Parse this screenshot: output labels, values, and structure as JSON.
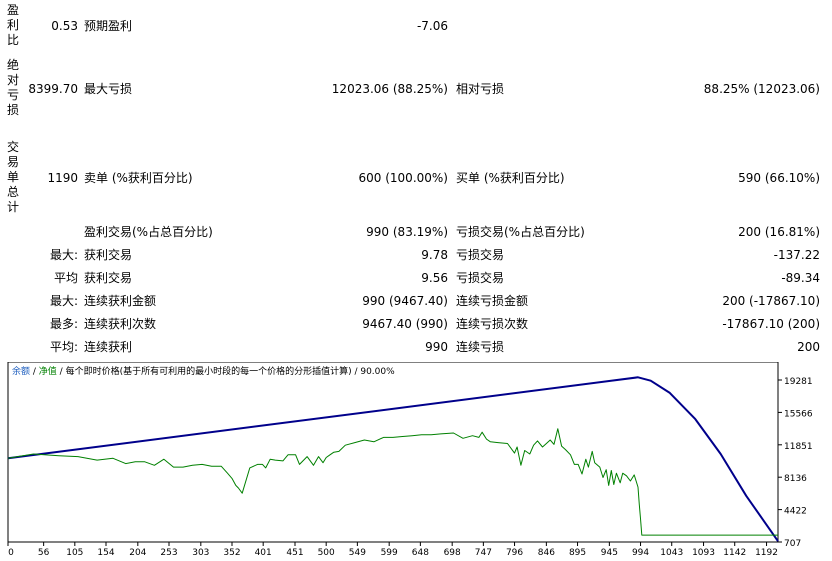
{
  "stats": {
    "groups": [
      {
        "label_chars": [
          "盈",
          "利",
          "比"
        ],
        "top": 3
      },
      {
        "label_chars": [
          "绝",
          "对",
          "亏",
          "损"
        ],
        "top": 58
      },
      {
        "label_chars": [
          "交",
          "易",
          "单",
          "总",
          "计"
        ],
        "top": 140
      }
    ],
    "rows": [
      {
        "num": "0.53",
        "l1": "预期盈利",
        "v1": "-7.06",
        "l2": "",
        "v2": ""
      },
      {
        "num": "8399.70",
        "l1": "最大亏损",
        "v1": "12023.06 (88.25%)",
        "l2": "相对亏损",
        "v2": "88.25% (12023.06)"
      },
      {
        "num": "1190",
        "l1": "卖单 (%获利百分比)",
        "v1": "600 (100.00%)",
        "l2": "买单 (%获利百分比)",
        "v2": "590 (66.10%)"
      },
      {
        "num": "",
        "l1": "盈利交易(%占总百分比)",
        "v1": "990 (83.19%)",
        "l2": "亏损交易(%占总百分比)",
        "v2": "200 (16.81%)"
      },
      {
        "num": "最大:",
        "l1": "获利交易",
        "v1": "9.78",
        "l2": "亏损交易",
        "v2": "-137.22"
      },
      {
        "num": "平均",
        "l1": "获利交易",
        "v1": "9.56",
        "l2": "亏损交易",
        "v2": "-89.34"
      },
      {
        "num": "最大:",
        "l1": "连续获利金额",
        "v1": "990 (9467.40)",
        "l2": "连续亏损金额",
        "v2": "200 (-17867.10)"
      },
      {
        "num": "最多:",
        "l1": "连续获利次数",
        "v1": "9467.40 (990)",
        "l2": "连续亏损次数",
        "v2": "-17867.10 (200)"
      },
      {
        "num": "平均:",
        "l1": "连续获利",
        "v1": "990",
        "l2": "连续亏损",
        "v2": "200"
      }
    ]
  },
  "chart_data": {
    "type": "line",
    "legend": {
      "items": [
        "余额",
        "净值",
        "每个即时价格(基于所有可利用的最小时段的每一个价格的分形插值计算)",
        "90.00%"
      ],
      "separator": " / "
    },
    "x_ticks": [
      0,
      56,
      105,
      154,
      204,
      253,
      303,
      352,
      401,
      451,
      500,
      549,
      599,
      648,
      698,
      747,
      796,
      846,
      895,
      945,
      994,
      1043,
      1093,
      1142,
      1192
    ],
    "y_ticks": [
      19281,
      15566,
      11851,
      8136,
      4422,
      707
    ],
    "xlim": [
      0,
      1210
    ],
    "ylim": [
      707,
      19281
    ],
    "colors": {
      "balance": "#00008b",
      "equity": "#008000",
      "axis": "#000000",
      "legend_balance": "#1f5fbf",
      "legend_equity": "#008000"
    },
    "series": [
      {
        "name": "余额",
        "key": "balance",
        "x": [
          0,
          990,
          1010,
          1040,
          1080,
          1120,
          1160,
          1210
        ],
        "y": [
          10300,
          19590,
          19200,
          17800,
          14800,
          10800,
          6000,
          800
        ]
      },
      {
        "name": "净值",
        "key": "equity",
        "x": [
          0,
          40,
          80,
          110,
          140,
          165,
          185,
          200,
          215,
          230,
          245,
          260,
          275,
          290,
          305,
          320,
          335,
          345,
          352,
          358,
          362,
          368,
          380,
          392,
          400,
          405,
          412,
          420,
          432,
          440,
          452,
          458,
          470,
          480,
          488,
          495,
          500,
          506,
          512,
          520,
          530,
          545,
          560,
          575,
          590,
          605,
          620,
          635,
          650,
          665,
          680,
          700,
          715,
          730,
          740,
          745,
          752,
          758,
          770,
          785,
          796,
          800,
          806,
          812,
          820,
          826,
          832,
          840,
          846,
          852,
          858,
          864,
          870,
          876,
          884,
          890,
          896,
          902,
          908,
          912,
          918,
          922,
          930,
          935,
          940,
          944,
          948,
          952,
          956,
          962,
          966,
          972,
          978,
          984,
          990,
          992,
          994,
          996,
          1000,
          1100,
          1150,
          1210
        ],
        "y": [
          10300,
          10800,
          10600,
          10500,
          10100,
          10300,
          9700,
          9900,
          9900,
          9500,
          10200,
          9300,
          9300,
          9500,
          9600,
          9400,
          9400,
          8600,
          8000,
          7200,
          6900,
          6300,
          9200,
          9600,
          9600,
          9200,
          10200,
          10100,
          10000,
          10700,
          10700,
          9600,
          10500,
          9500,
          10500,
          9800,
          10400,
          10700,
          11000,
          11100,
          11800,
          12100,
          12400,
          12200,
          12700,
          12700,
          12800,
          12900,
          13000,
          13000,
          13100,
          13200,
          12600,
          12900,
          12700,
          13300,
          12500,
          12200,
          12100,
          12000,
          10900,
          11600,
          9500,
          11200,
          10800,
          11800,
          12300,
          11600,
          12000,
          12400,
          11900,
          13700,
          11700,
          11300,
          10700,
          9600,
          9600,
          8500,
          10200,
          9300,
          11100,
          9800,
          9300,
          8100,
          9000,
          7200,
          8900,
          7300,
          8600,
          7500,
          8600,
          8300,
          7700,
          8400,
          7000,
          5000,
          3400,
          1500,
          1500,
          1500,
          1500,
          1500
        ]
      }
    ]
  }
}
